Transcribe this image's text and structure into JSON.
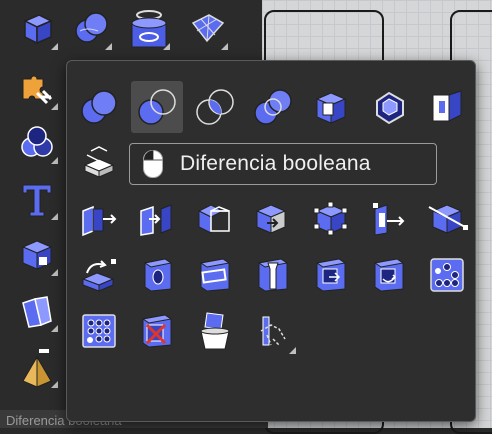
{
  "tooltip": {
    "label": "Diferencia booleana",
    "icon": "mouse-left-click-icon"
  },
  "status_bar": {
    "text": "Diferencia booleana"
  },
  "colors": {
    "panel_bg": "#2e2e2e",
    "icon_blue": "#5b6cf0",
    "icon_blue_dark": "#2f3aa8",
    "tooltip_border": "#9a9a9a",
    "viewport_bg": "#d4d6d8"
  },
  "left_toolbar_icons": [
    "box-icon",
    "boolean-union-icon",
    "cylinder-icon",
    "surface-icon",
    "puzzle-tools-icon",
    "three-spheres-icon",
    "text-icon",
    "box-variant-icon",
    "extrude-icon",
    "pyramid-icon"
  ],
  "flyout_icons": [
    "boolean-union-icon",
    "boolean-difference-icon",
    "boolean-intersection-icon",
    "boolean-split-icon",
    "cap-holes-icon",
    "extract-surface-icon",
    "split-icon",
    "stack-layers-icon",
    "extrude-face-icon",
    "move-face-icon",
    "offset-solid-icon",
    "move-edge-icon",
    "edit-points-icon",
    "move-face-arrow-icon",
    "cut-slice-icon",
    "rotate-face-icon",
    "hole-icon",
    "slot-icon",
    "counterbore-icon",
    "move-hole-icon",
    "rotate-hole-icon",
    "array-holes-grid-icon",
    "array-holes-icon",
    "delete-hole-icon",
    "trim-bucket-icon",
    "wire-cut-icon"
  ]
}
